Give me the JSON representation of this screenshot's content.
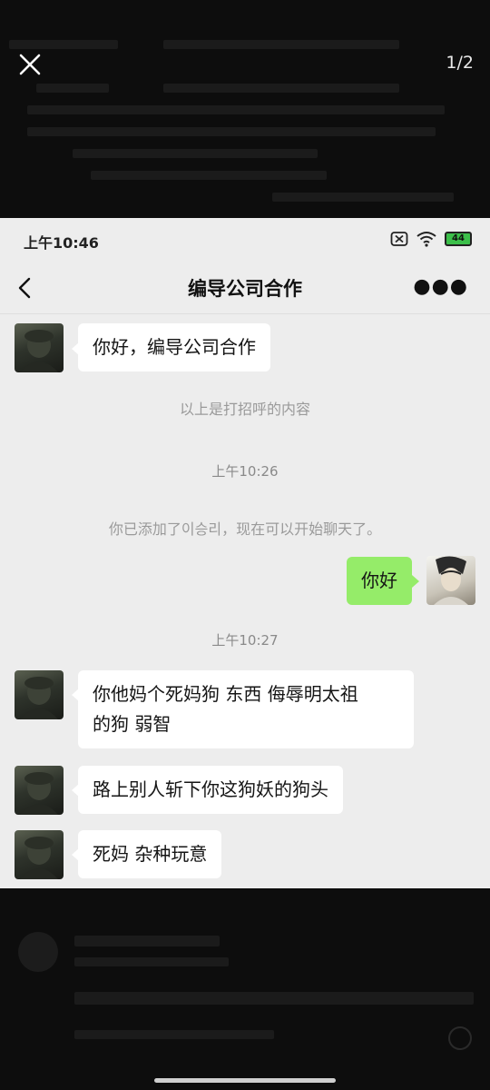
{
  "viewer": {
    "page_indicator": "1/2"
  },
  "status_bar": {
    "time": "上午10:46",
    "battery": "44"
  },
  "header": {
    "title": "编导公司合作"
  },
  "messages": [
    {
      "text": "你好，编导公司合作"
    },
    {
      "text": "你好"
    },
    {
      "line1": "你他妈个死妈狗 东西 侮辱明太祖",
      "line2": "的狗 弱智"
    },
    {
      "text": "路上别人斩下你这狗妖的狗头"
    },
    {
      "text": "死妈 杂种玩意"
    }
  ],
  "system": {
    "greeting_note": "以上是打招呼的内容",
    "added_note": "你已添加了이승리，现在可以开始聊天了。"
  },
  "timestamps": [
    "上午10:26",
    "上午10:27"
  ],
  "icons": {
    "close": "close-icon",
    "back": "back-arrow-icon",
    "more": "more-dots-icon",
    "wifi": "wifi-icon",
    "sim": "no-sim-icon"
  },
  "colors": {
    "chat_bg": "#ededed",
    "my_bubble": "#95ec69",
    "other_bubble": "#ffffff"
  }
}
